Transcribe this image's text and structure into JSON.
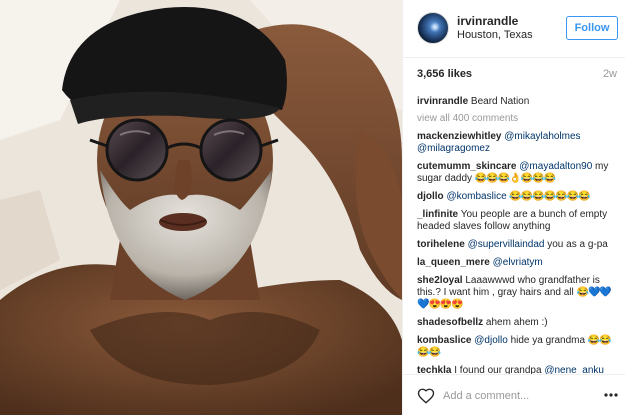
{
  "post": {
    "photo_alt_icon": "portrait-photo",
    "header": {
      "username": "irvinrandle",
      "location": "Houston, Texas",
      "follow_label": "Follow"
    },
    "likes": "3,656 likes",
    "age": "2w",
    "caption": {
      "username": "irvinrandle",
      "text": "Beard Nation"
    },
    "view_all": "view all 400 comments",
    "comments": [
      {
        "username": "mackenziewhitley",
        "mentions": [
          "@mikaylaholmes",
          "@milagragomez"
        ],
        "text": "",
        "emoji": ""
      },
      {
        "username": "cutemumm_skincare",
        "mentions": [
          "@mayadalton90"
        ],
        "text": "my sugar daddy",
        "emoji": "😂😂😂👌😂😂😂"
      },
      {
        "username": "djollo",
        "mentions": [
          "@kombaslice"
        ],
        "text": "",
        "emoji": "😂😂😂😂😂😂😂"
      },
      {
        "username": "_linfinite",
        "mentions": [],
        "text": "You people are a bunch of empty headed slaves follow anything",
        "emoji": ""
      },
      {
        "username": "torihelene",
        "mentions": [
          "@supervillaindad"
        ],
        "text": "you as a g-pa",
        "emoji": ""
      },
      {
        "username": "la_queen_mere",
        "mentions": [
          "@elvriatym"
        ],
        "text": "",
        "emoji": ""
      },
      {
        "username": "she2loyal",
        "mentions": [],
        "text": "Laaawwwd who grandfather is this.? I want him , gray hairs and all",
        "emoji": "😂💙💙💙😍😍😍"
      },
      {
        "username": "shadesofbellz",
        "mentions": [],
        "text": "ahem ahem :)",
        "emoji": ""
      },
      {
        "username": "kombaslice",
        "mentions": [
          "@djollo"
        ],
        "text": "hide ya grandma",
        "emoji": "😂😂😂😂"
      },
      {
        "username": "techkla",
        "mentions": [
          "@nene_anku"
        ],
        "text": "I found our grandpa",
        "emoji": ""
      }
    ],
    "add_comment_placeholder": "Add a comment...",
    "icons": {
      "like": "heart-icon",
      "more": "more-options-icon"
    },
    "colors": {
      "accent": "#3897f0",
      "mention": "#003569",
      "muted": "#999999"
    }
  }
}
